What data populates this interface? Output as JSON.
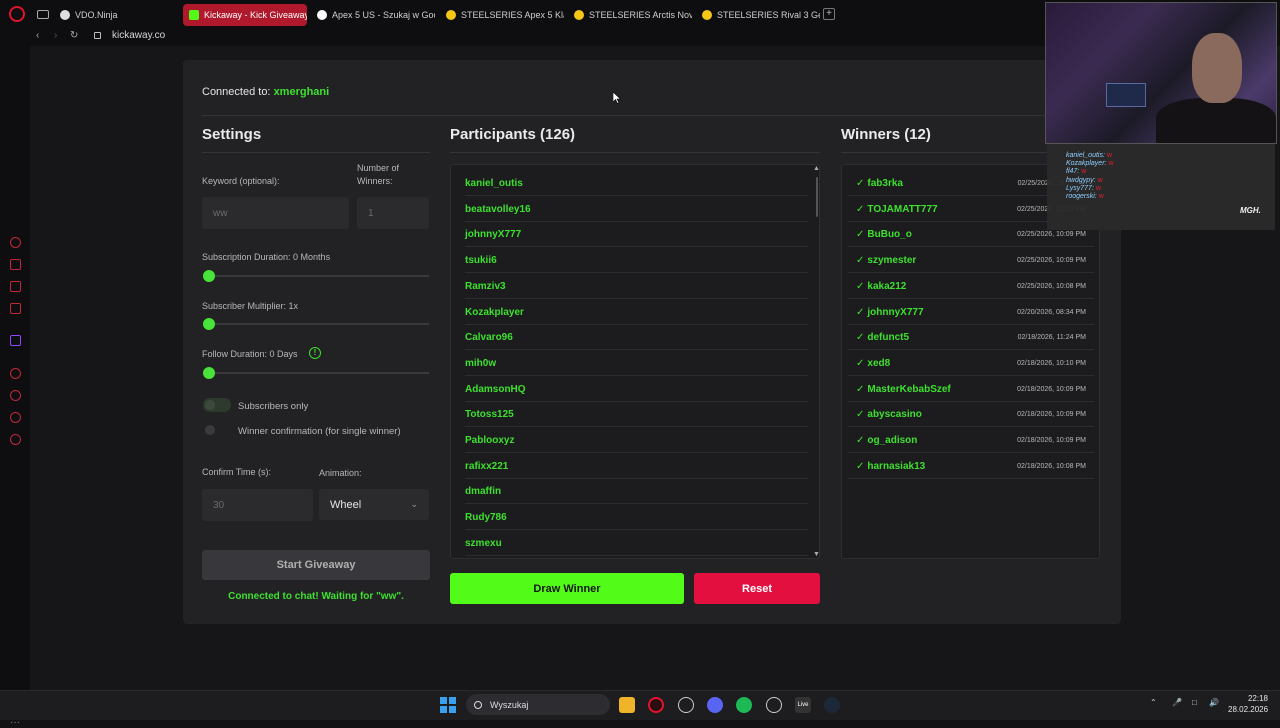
{
  "browser": {
    "tabs": [
      {
        "label": "VDO.Ninja",
        "active": false
      },
      {
        "label": "Kickaway - Kick Giveaway",
        "active": true
      },
      {
        "label": "Apex 5 US - Szukaj w Goo",
        "active": false
      },
      {
        "label": "STEELSERIES Apex 5 Klaw",
        "active": false
      },
      {
        "label": "STEELSERIES Arctis Nova",
        "active": false
      },
      {
        "label": "STEELSERIES Rival 3 Gen",
        "active": false
      }
    ],
    "new_tab": "+",
    "url": "kickaway.co"
  },
  "connection": {
    "prefix": "Connected to:",
    "channel": "xmerghani"
  },
  "settings": {
    "title": "Settings",
    "keyword_label": "Keyword (optional):",
    "keyword_value": "ww",
    "winners_label": "Number of Winners:",
    "winners_value": "1",
    "subscription_label": "Subscription Duration: 0 Months",
    "subscription_level": 0,
    "multiplier_label": "Subscriber Multiplier: 1x",
    "multiplier_level": 0,
    "follow_label": "Follow Duration: 0 Days",
    "follow_level": 0,
    "follow_info": "!",
    "subs_only_label": "Subscribers only",
    "subs_only_on": false,
    "winner_confirm_label": "Winner confirmation (for single winner)",
    "winner_confirm_on": false,
    "confirm_time_label": "Confirm Time (s):",
    "confirm_time_value": "30",
    "animation_label": "Animation:",
    "animation_value": "Wheel",
    "start_button": "Start Giveaway",
    "status": "Connected to chat! Waiting for \"ww\"."
  },
  "participants": {
    "title": "Participants (126)",
    "items": [
      "kaniel_outis",
      "beatavolley16",
      "johnnyX777",
      "tsukii6",
      "Ramziv3",
      "Kozakplayer",
      "Calvaro96",
      "mih0w",
      "AdamsonHQ",
      "Totoss125",
      "Pablooxyz",
      "rafixx221",
      "dmaffin",
      "Rudy786",
      "szmexu"
    ]
  },
  "winners": {
    "title": "Winners (12)",
    "check": "✓",
    "items": [
      {
        "name": "fab3rka",
        "date": "02/25/2026, 10:11 PM"
      },
      {
        "name": "TOJAMATT777",
        "date": "02/25/2026, 10:10 PM"
      },
      {
        "name": "BuBuo_o",
        "date": "02/25/2026, 10:09 PM"
      },
      {
        "name": "szymester",
        "date": "02/25/2026, 10:09 PM"
      },
      {
        "name": "kaka212",
        "date": "02/25/2026, 10:08 PM"
      },
      {
        "name": "johnnyX777",
        "date": "02/20/2026, 08:34 PM"
      },
      {
        "name": "defunct5",
        "date": "02/18/2026, 11:24 PM"
      },
      {
        "name": "xed8",
        "date": "02/18/2026, 10:10 PM"
      },
      {
        "name": "MasterKebabSzef",
        "date": "02/18/2026, 10:09 PM"
      },
      {
        "name": "abyscasino",
        "date": "02/18/2026, 10:09 PM"
      },
      {
        "name": "og_adison",
        "date": "02/18/2026, 10:09 PM"
      },
      {
        "name": "harnasiak13",
        "date": "02/18/2026, 10:08 PM"
      }
    ]
  },
  "actions": {
    "draw": "Draw Winner",
    "reset": "Reset"
  },
  "stream_chat": [
    {
      "user": "kaniel_outis:",
      "msg": "w"
    },
    {
      "user": "Kozakplayer:",
      "msg": "w"
    },
    {
      "user": "fl47:",
      "msg": "w"
    },
    {
      "user": "hwdgypy:",
      "msg": "w"
    },
    {
      "user": "Lysy777:",
      "msg": "w"
    },
    {
      "user": "roogerski:",
      "msg": "w"
    }
  ],
  "stream_logo": "MGH.",
  "taskbar": {
    "search_placeholder": "Wyszukaj",
    "time": "22:18",
    "date": "28.02.2026"
  },
  "colors": {
    "kick_green": "#53fc18",
    "name_green": "#3ee02e",
    "reset_red": "#e3103f",
    "opera_red": "#e1142d"
  }
}
